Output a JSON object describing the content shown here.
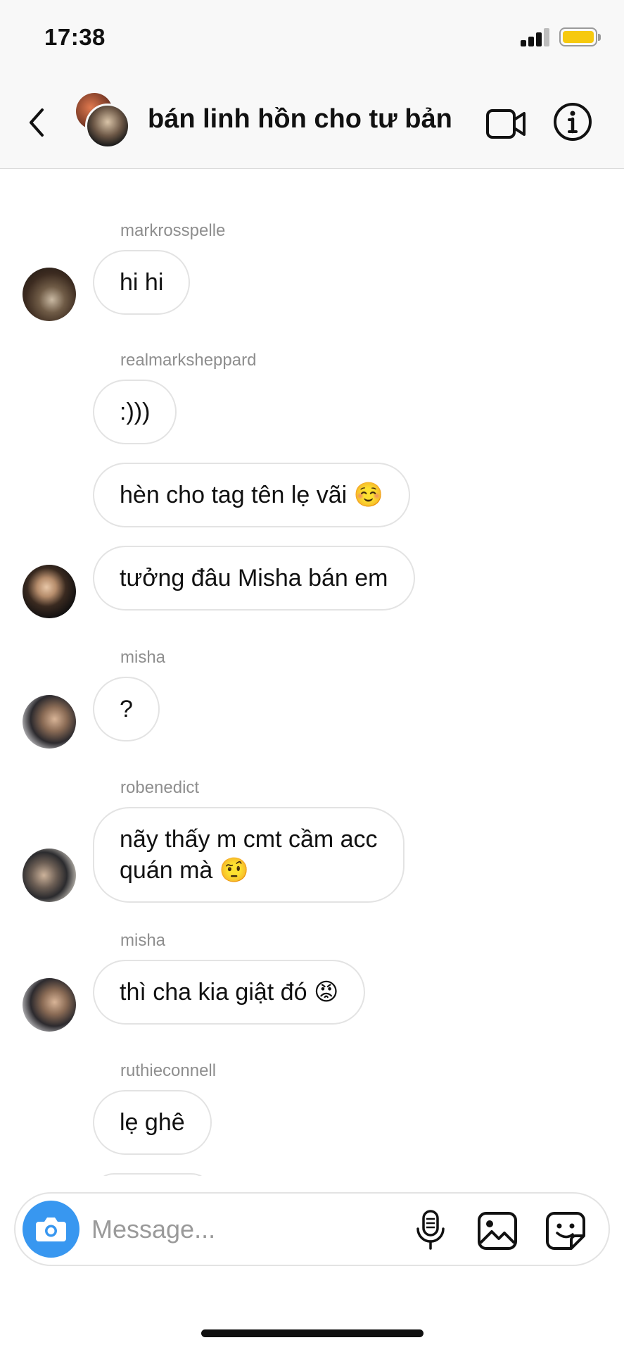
{
  "status_bar": {
    "time": "17:38"
  },
  "header": {
    "title": "bán linh hồn cho tư bản"
  },
  "messages": [
    {
      "sender": "markrosspelle",
      "bubbles": [
        "hi hi"
      ]
    },
    {
      "sender": "realmarksheppard",
      "bubbles": [
        ":)))",
        "hèn cho tag tên lẹ vãi",
        "tưởng đâu Misha bán em"
      ]
    },
    {
      "sender": "misha",
      "bubbles": [
        "?"
      ]
    },
    {
      "sender": "robenedict",
      "bubbles": [
        "nãy thấy m cmt cầm acc",
        "quán mà"
      ]
    },
    {
      "sender": "misha",
      "bubbles": [
        "thì cha kia giật đó"
      ]
    },
    {
      "sender": "ruthieconnell",
      "bubbles": [
        "lẹ ghê"
      ]
    }
  ],
  "emojis": {
    "smiling": "☺️",
    "raised_eyebrow": "🤨",
    "angry": "😡"
  },
  "composer": {
    "placeholder": "Message..."
  },
  "colors": {
    "camera_accent": "#3897f0",
    "battery": "#f6c90e",
    "bubble_border": "#e3e3e3",
    "sender_gray": "#8e8e8e"
  },
  "icons": [
    "back-chevron-icon",
    "video-call-icon",
    "info-icon",
    "camera-icon",
    "microphone-icon",
    "gallery-icon",
    "sticker-icon"
  ]
}
